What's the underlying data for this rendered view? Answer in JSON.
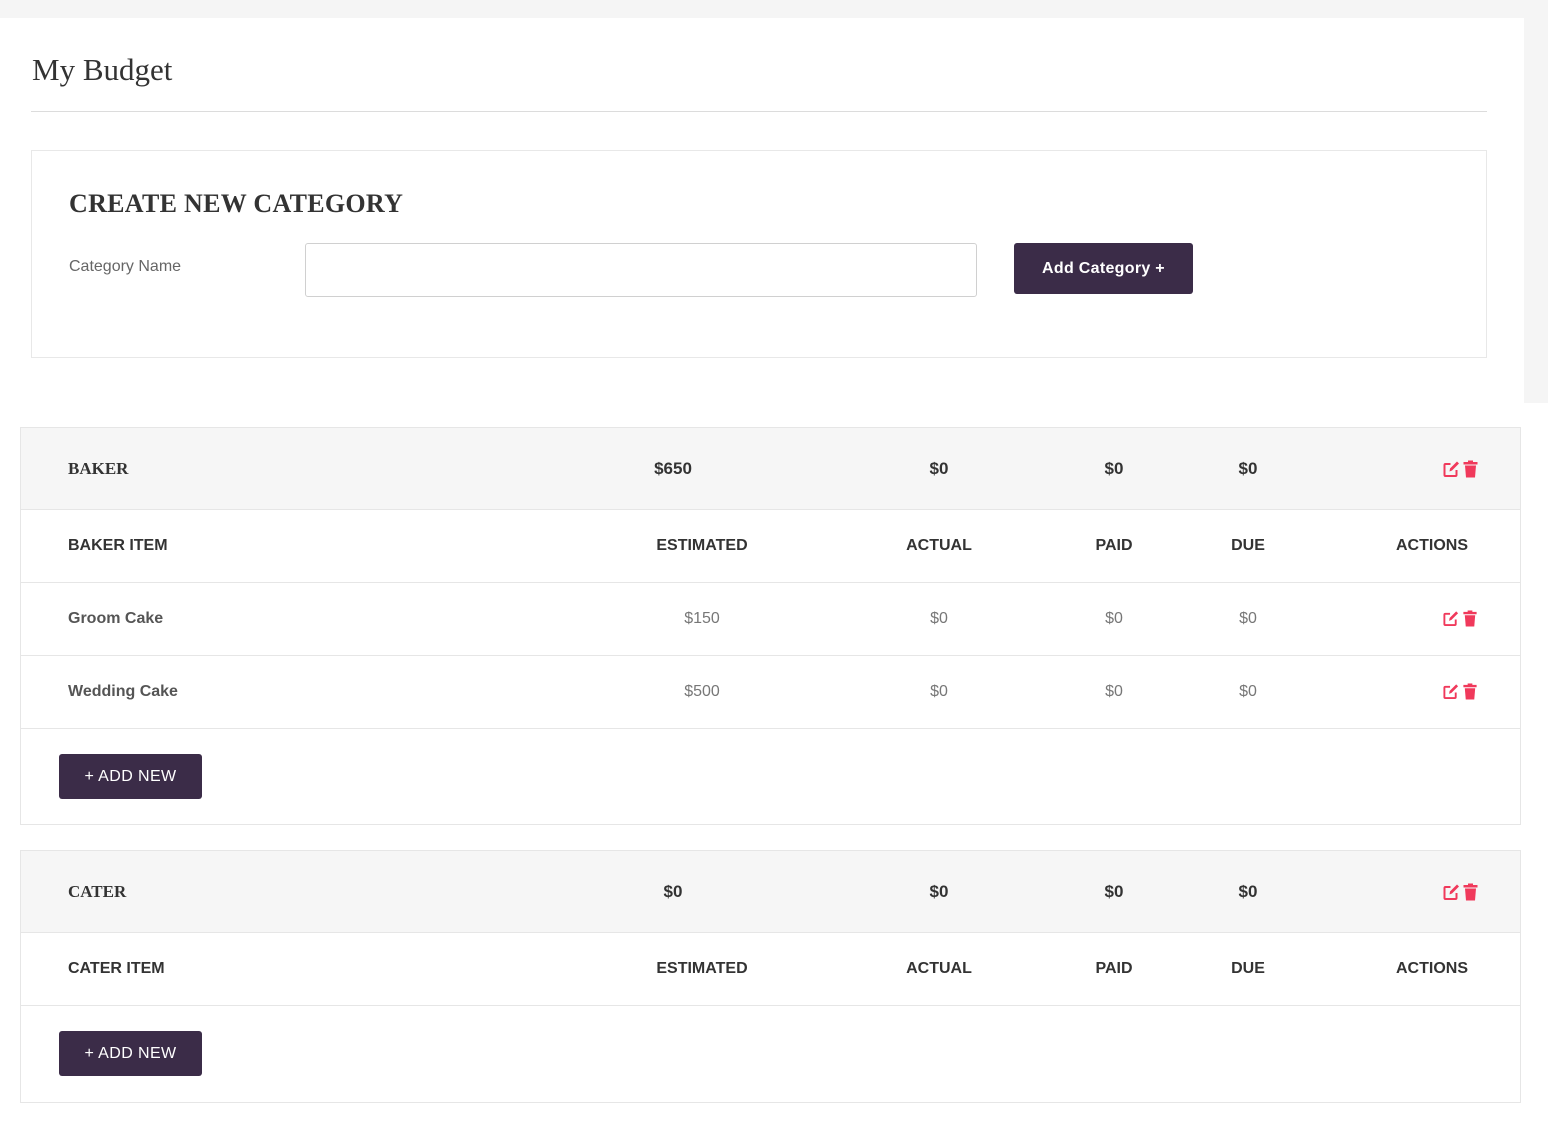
{
  "page": {
    "title": "My Budget"
  },
  "create": {
    "heading": "CREATE NEW CATEGORY",
    "label": "Category Name",
    "input_value": "",
    "button": "Add Category +"
  },
  "columns": {
    "estimated": "ESTIMATED",
    "actual": "ACTUAL",
    "paid": "PAID",
    "due": "DUE",
    "actions": "ACTIONS"
  },
  "categories": [
    {
      "name": "BAKER",
      "estimated": "$650",
      "actual": "$0",
      "paid": "$0",
      "due": "$0",
      "item_header": "BAKER ITEM",
      "items": [
        {
          "name": "Groom Cake",
          "estimated": "$150",
          "actual": "$0",
          "paid": "$0",
          "due": "$0"
        },
        {
          "name": "Wedding Cake",
          "estimated": "$500",
          "actual": "$0",
          "paid": "$0",
          "due": "$0"
        }
      ],
      "add_button": "+ ADD NEW"
    },
    {
      "name": "CATER",
      "estimated": "$0",
      "actual": "$0",
      "paid": "$0",
      "due": "$0",
      "item_header": "CATER ITEM",
      "items": [],
      "add_button": "+ ADD NEW"
    }
  ],
  "icons": {
    "edit": "edit-icon",
    "delete": "trash-icon"
  },
  "colors": {
    "accent": "#3b2c48",
    "icon": "#f0395b",
    "header_bg": "#f6f6f6"
  }
}
